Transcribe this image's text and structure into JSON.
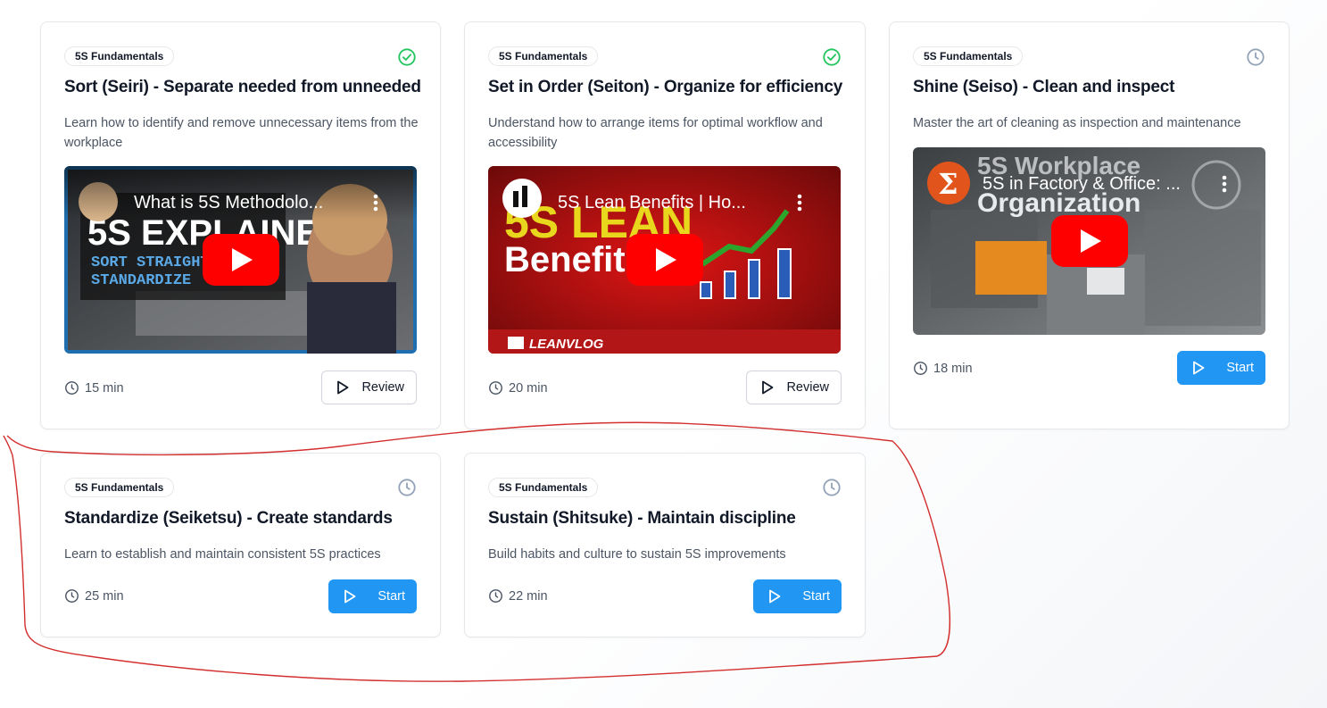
{
  "colors": {
    "primary": "#2196f3",
    "completed": "#22c55e",
    "pending": "#94a3b8",
    "annotation": "#d32f2f"
  },
  "cards": [
    {
      "badge": "5S Fundamentals",
      "status_icon": "check-circle-icon",
      "title": "Sort (Seiri) - Separate needed from unneeded",
      "description": "Learn how to identify and remove unnecessary items from the workplace",
      "video": {
        "title": "What is 5S Methodolo...",
        "overlay_lines": [
          "5S EXPLAINED",
          "SORT STRAIGHT",
          "STANDARDIZE"
        ]
      },
      "duration": "15 min",
      "button": "Review"
    },
    {
      "badge": "5S Fundamentals",
      "status_icon": "check-circle-icon",
      "title": "Set in Order (Seiton) - Organize for efficiency",
      "description": "Understand how to arrange items for optimal workflow and accessibility",
      "video": {
        "title": "5S Lean Benefits | Ho...",
        "overlay_lines": [
          "5S LEAN",
          "Benefits",
          "LEANVLOG"
        ]
      },
      "duration": "20 min",
      "button": "Review"
    },
    {
      "badge": "5S Fundamentals",
      "status_icon": "clock-icon",
      "title": "Shine (Seiso) - Clean and inspect",
      "description": "Master the art of cleaning as inspection and maintenance",
      "video": {
        "title": "5S in Factory & Office: ...",
        "overlay_lines": [
          "5S Workplace",
          "Organization"
        ]
      },
      "duration": "18 min",
      "button": "Start"
    },
    {
      "badge": "5S Fundamentals",
      "status_icon": "clock-icon",
      "title": "Standardize (Seiketsu) - Create standards",
      "description": "Learn to establish and maintain consistent 5S practices",
      "duration": "25 min",
      "button": "Start"
    },
    {
      "badge": "5S Fundamentals",
      "status_icon": "clock-icon",
      "title": "Sustain (Shitsuke) - Maintain discipline",
      "description": "Build habits and culture to sustain 5S improvements",
      "duration": "22 min",
      "button": "Start"
    }
  ]
}
